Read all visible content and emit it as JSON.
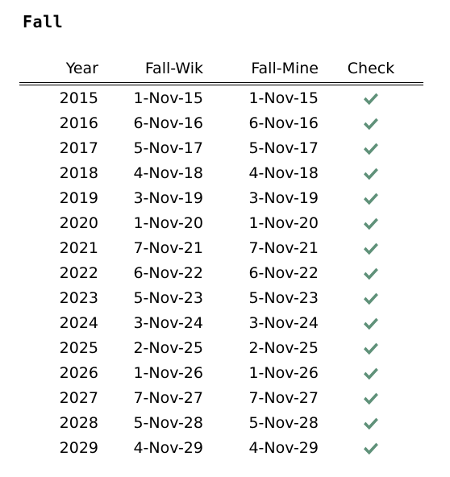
{
  "title": "Fall",
  "colors": {
    "check_green": "#5f9179",
    "text": "#000000",
    "rule": "#000000",
    "background": "#ffffff"
  },
  "table": {
    "columns": [
      {
        "key": "year",
        "label": "Year"
      },
      {
        "key": "fall_wik",
        "label": "Fall-Wik"
      },
      {
        "key": "fall_mine",
        "label": "Fall-Mine"
      },
      {
        "key": "check",
        "label": "Check"
      }
    ],
    "check_icon": "check-mark-icon",
    "rows": [
      {
        "year": "2015",
        "fall_wik": "1-Nov-15",
        "fall_mine": "1-Nov-15",
        "check": true
      },
      {
        "year": "2016",
        "fall_wik": "6-Nov-16",
        "fall_mine": "6-Nov-16",
        "check": true
      },
      {
        "year": "2017",
        "fall_wik": "5-Nov-17",
        "fall_mine": "5-Nov-17",
        "check": true
      },
      {
        "year": "2018",
        "fall_wik": "4-Nov-18",
        "fall_mine": "4-Nov-18",
        "check": true
      },
      {
        "year": "2019",
        "fall_wik": "3-Nov-19",
        "fall_mine": "3-Nov-19",
        "check": true
      },
      {
        "year": "2020",
        "fall_wik": "1-Nov-20",
        "fall_mine": "1-Nov-20",
        "check": true
      },
      {
        "year": "2021",
        "fall_wik": "7-Nov-21",
        "fall_mine": "7-Nov-21",
        "check": true
      },
      {
        "year": "2022",
        "fall_wik": "6-Nov-22",
        "fall_mine": "6-Nov-22",
        "check": true
      },
      {
        "year": "2023",
        "fall_wik": "5-Nov-23",
        "fall_mine": "5-Nov-23",
        "check": true
      },
      {
        "year": "2024",
        "fall_wik": "3-Nov-24",
        "fall_mine": "3-Nov-24",
        "check": true
      },
      {
        "year": "2025",
        "fall_wik": "2-Nov-25",
        "fall_mine": "2-Nov-25",
        "check": true
      },
      {
        "year": "2026",
        "fall_wik": "1-Nov-26",
        "fall_mine": "1-Nov-26",
        "check": true
      },
      {
        "year": "2027",
        "fall_wik": "7-Nov-27",
        "fall_mine": "7-Nov-27",
        "check": true
      },
      {
        "year": "2028",
        "fall_wik": "5-Nov-28",
        "fall_mine": "5-Nov-28",
        "check": true
      },
      {
        "year": "2029",
        "fall_wik": "4-Nov-29",
        "fall_mine": "4-Nov-29",
        "check": true
      }
    ]
  }
}
